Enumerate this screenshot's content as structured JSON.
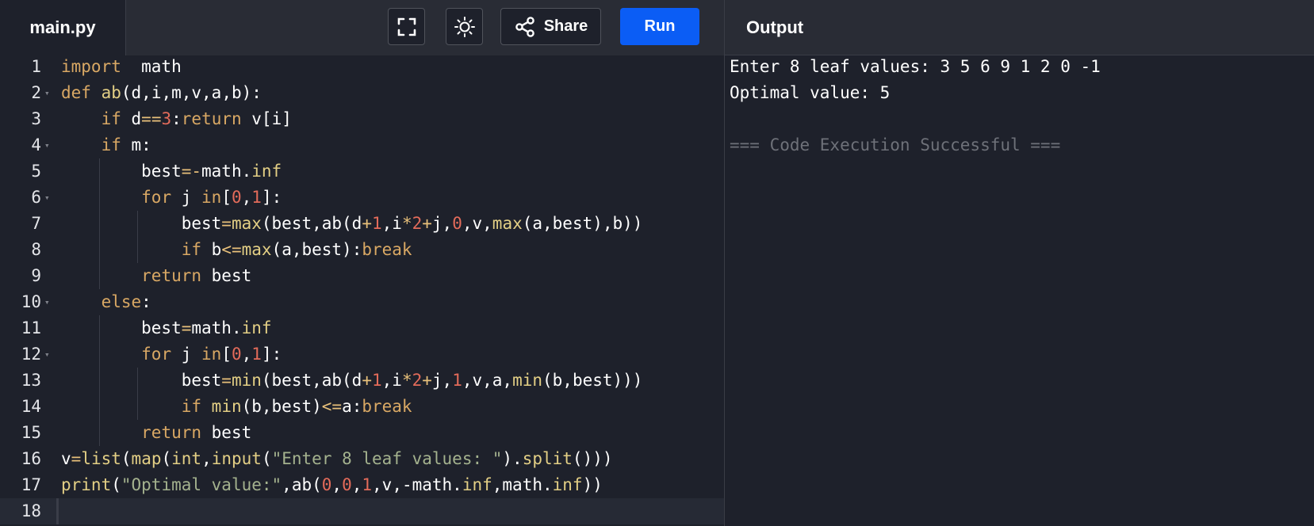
{
  "header": {
    "file_tab": "main.py",
    "share_label": "Share",
    "run_label": "Run",
    "output_title": "Output",
    "icons": {
      "fullscreen": "fullscreen-icon",
      "theme": "sun-icon",
      "share": "share-icon"
    }
  },
  "colors": {
    "background": "#1e212b",
    "topbar": "#292c35",
    "run_button": "#0b5df5",
    "keyword": "#d9a864",
    "number": "#e36b5a",
    "string": "#a4b28e",
    "builtin": "#e3cf85"
  },
  "editor": {
    "line_numbers": [
      "1",
      "2",
      "3",
      "4",
      "5",
      "6",
      "7",
      "8",
      "9",
      "10",
      "11",
      "12",
      "13",
      "14",
      "15",
      "16",
      "17",
      "18"
    ],
    "lines": [
      [
        [
          "kw",
          "import"
        ],
        [
          "",
          "  math"
        ]
      ],
      [
        [
          "kw",
          "def"
        ],
        [
          "",
          " "
        ],
        [
          "bi",
          "ab"
        ],
        [
          "",
          "(d,i,m,v,a,b):"
        ]
      ],
      [
        [
          "",
          "    "
        ],
        [
          "kw",
          "if"
        ],
        [
          "",
          " d"
        ],
        [
          "op",
          "=="
        ],
        [
          "num",
          "3"
        ],
        [
          "",
          ":"
        ],
        [
          "kw",
          "return"
        ],
        [
          "",
          " v[i]"
        ]
      ],
      [
        [
          "",
          "    "
        ],
        [
          "kw",
          "if"
        ],
        [
          "",
          " m:"
        ]
      ],
      [
        [
          "",
          "        best"
        ],
        [
          "op",
          "=-"
        ],
        [
          "",
          "math."
        ],
        [
          "bi",
          "inf"
        ]
      ],
      [
        [
          "",
          "        "
        ],
        [
          "kw",
          "for"
        ],
        [
          "",
          " j "
        ],
        [
          "kw",
          "in"
        ],
        [
          "",
          "["
        ],
        [
          "num",
          "0"
        ],
        [
          "",
          ","
        ],
        [
          "num",
          "1"
        ],
        [
          "",
          "]:"
        ]
      ],
      [
        [
          "",
          "            best"
        ],
        [
          "op",
          "="
        ],
        [
          "bi",
          "max"
        ],
        [
          "",
          "(best,ab(d"
        ],
        [
          "op",
          "+"
        ],
        [
          "num",
          "1"
        ],
        [
          "",
          ",i"
        ],
        [
          "op",
          "*"
        ],
        [
          "num",
          "2"
        ],
        [
          "op",
          "+"
        ],
        [
          "",
          "j,"
        ],
        [
          "num",
          "0"
        ],
        [
          "",
          ",v,"
        ],
        [
          "bi",
          "max"
        ],
        [
          "",
          "(a,best),b))"
        ]
      ],
      [
        [
          "",
          "            "
        ],
        [
          "kw",
          "if"
        ],
        [
          "",
          " b"
        ],
        [
          "op",
          "<="
        ],
        [
          "bi",
          "max"
        ],
        [
          "",
          "(a,best):"
        ],
        [
          "kw",
          "break"
        ]
      ],
      [
        [
          "",
          "        "
        ],
        [
          "kw",
          "return"
        ],
        [
          "",
          " best"
        ]
      ],
      [
        [
          "",
          "    "
        ],
        [
          "kw",
          "else"
        ],
        [
          "",
          ":"
        ]
      ],
      [
        [
          "",
          "        best"
        ],
        [
          "op",
          "="
        ],
        [
          "",
          "math."
        ],
        [
          "bi",
          "inf"
        ]
      ],
      [
        [
          "",
          "        "
        ],
        [
          "kw",
          "for"
        ],
        [
          "",
          " j "
        ],
        [
          "kw",
          "in"
        ],
        [
          "",
          "["
        ],
        [
          "num",
          "0"
        ],
        [
          "",
          ","
        ],
        [
          "num",
          "1"
        ],
        [
          "",
          "]:"
        ]
      ],
      [
        [
          "",
          "            best"
        ],
        [
          "op",
          "="
        ],
        [
          "bi",
          "min"
        ],
        [
          "",
          "(best,ab(d"
        ],
        [
          "op",
          "+"
        ],
        [
          "num",
          "1"
        ],
        [
          "",
          ",i"
        ],
        [
          "op",
          "*"
        ],
        [
          "num",
          "2"
        ],
        [
          "op",
          "+"
        ],
        [
          "",
          "j,"
        ],
        [
          "num",
          "1"
        ],
        [
          "",
          ",v,a,"
        ],
        [
          "bi",
          "min"
        ],
        [
          "",
          "(b,best)))"
        ]
      ],
      [
        [
          "",
          "            "
        ],
        [
          "kw",
          "if"
        ],
        [
          "",
          " "
        ],
        [
          "bi",
          "min"
        ],
        [
          "",
          "(b,best)"
        ],
        [
          "op",
          "<="
        ],
        [
          "",
          "a:"
        ],
        [
          "kw",
          "break"
        ]
      ],
      [
        [
          "",
          "        "
        ],
        [
          "kw",
          "return"
        ],
        [
          "",
          " best"
        ]
      ],
      [
        [
          "",
          "v"
        ],
        [
          "op",
          "="
        ],
        [
          "bi",
          "list"
        ],
        [
          "",
          "("
        ],
        [
          "bi",
          "map"
        ],
        [
          "",
          "("
        ],
        [
          "bi",
          "int"
        ],
        [
          "",
          ","
        ],
        [
          "bi",
          "input"
        ],
        [
          "",
          "("
        ],
        [
          "str",
          "\"Enter 8 leaf values: \""
        ],
        [
          "",
          ")."
        ],
        [
          "bi",
          "split"
        ],
        [
          "",
          "()))"
        ]
      ],
      [
        [
          "bi",
          "print"
        ],
        [
          "",
          "("
        ],
        [
          "str",
          "\"Optimal value:\""
        ],
        [
          "",
          ",ab("
        ],
        [
          "num",
          "0"
        ],
        [
          "",
          ","
        ],
        [
          "num",
          "0"
        ],
        [
          "",
          ","
        ],
        [
          "num",
          "1"
        ],
        [
          "",
          ",v,-math."
        ],
        [
          "bi",
          "inf"
        ],
        [
          "",
          ",math."
        ],
        [
          "bi",
          "inf"
        ],
        [
          "",
          "))"
        ]
      ],
      []
    ],
    "fold_lines": [
      2,
      4,
      6,
      10,
      12
    ]
  },
  "output": {
    "lines": [
      "Enter 8 leaf values: 3 5 6 9 1 2 0 -1",
      "Optimal value: 5",
      "",
      "=== Code Execution Successful ==="
    ]
  }
}
